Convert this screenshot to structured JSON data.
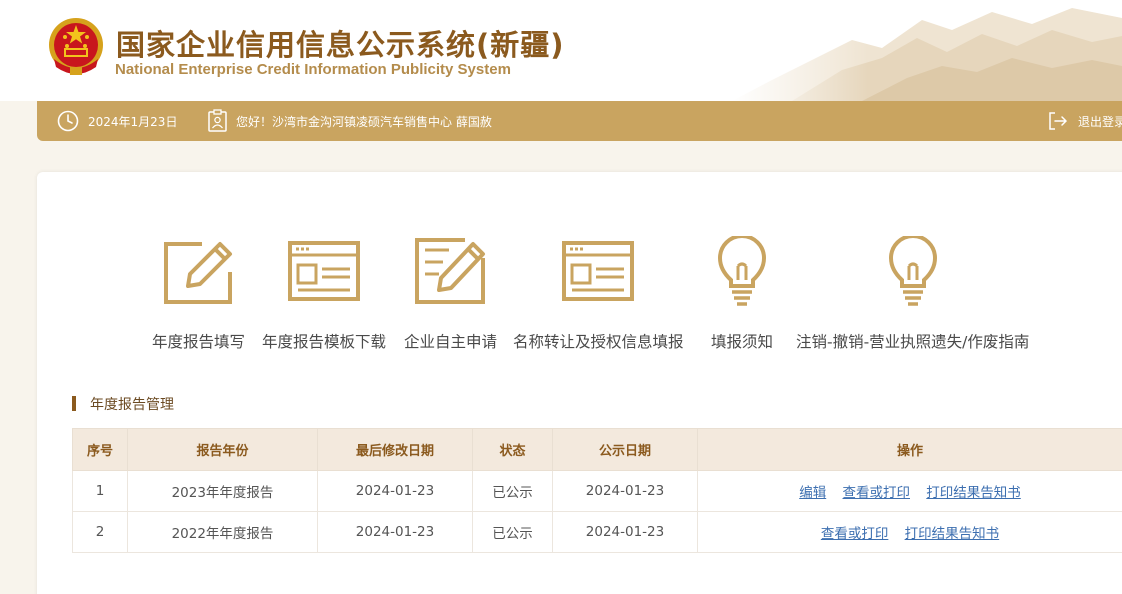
{
  "header": {
    "title": "国家企业信用信息公示系统(新疆)",
    "subtitle": "National Enterprise Credit Information Publicity System"
  },
  "infobar": {
    "date": "2024年1月23日",
    "greeting": "您好！沙湾市金沟河镇凌硕汽车销售中心  薛国赦",
    "logout": "退出登录",
    "icons": [
      "clock-icon",
      "user-card-icon",
      "logout-icon"
    ]
  },
  "quick_actions": [
    {
      "label": "年度报告填写",
      "icon": "edit-icon"
    },
    {
      "label": "年度报告模板下载",
      "icon": "template-icon"
    },
    {
      "label": "企业自主申请",
      "icon": "document-edit-icon"
    },
    {
      "label": "名称转让及授权信息填报",
      "icon": "form-icon"
    },
    {
      "label": "填报须知",
      "icon": "lightbulb-icon"
    },
    {
      "label": "注销-撤销-营业执照遗失/作废指南",
      "icon": "lightbulb-icon"
    }
  ],
  "section": {
    "title": "年度报告管理"
  },
  "table": {
    "headers": [
      "序号",
      "报告年份",
      "最后修改日期",
      "状态",
      "公示日期",
      "操作"
    ],
    "rows": [
      {
        "no": "1",
        "year": "2023年年度报告",
        "modified": "2024-01-23",
        "status": "已公示",
        "published": "2024-01-23",
        "actions": [
          "编辑",
          "查看或打印",
          "打印结果告知书"
        ]
      },
      {
        "no": "2",
        "year": "2022年年度报告",
        "modified": "2024-01-23",
        "status": "已公示",
        "published": "2024-01-23",
        "actions": [
          "查看或打印",
          "打印结果告知书"
        ]
      }
    ]
  },
  "colors": {
    "gold": "#c9a460",
    "brown": "#8b5a1e",
    "link": "#3d6fb0",
    "table_header_bg": "#f3e9dd"
  }
}
